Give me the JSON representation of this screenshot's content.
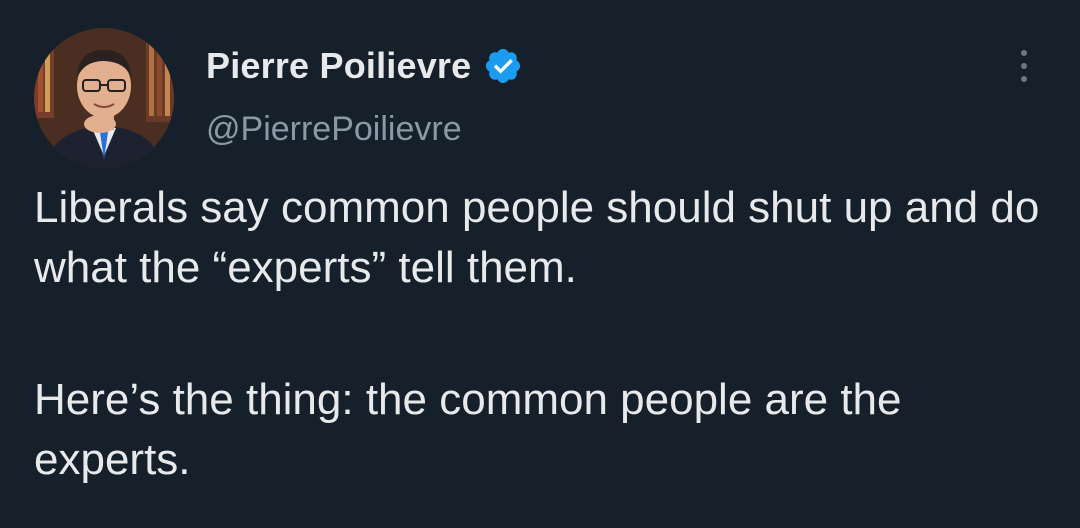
{
  "tweet": {
    "author": {
      "display_name": "Pierre Poilievre",
      "handle": "@PierrePoilievre",
      "verified": true,
      "verified_color": "#1d9bf0",
      "avatar_icon": "profile-photo"
    },
    "more_icon": "more-vertical-icon",
    "text": {
      "paragraph_1": "Liberals say common people should shut up and do what the “experts” tell them.",
      "paragraph_2": "Here’s the thing: the common people are the experts."
    }
  },
  "theme": {
    "background": "#15202b",
    "text_primary": "#e7e9ea",
    "text_secondary": "#8b98a5"
  }
}
